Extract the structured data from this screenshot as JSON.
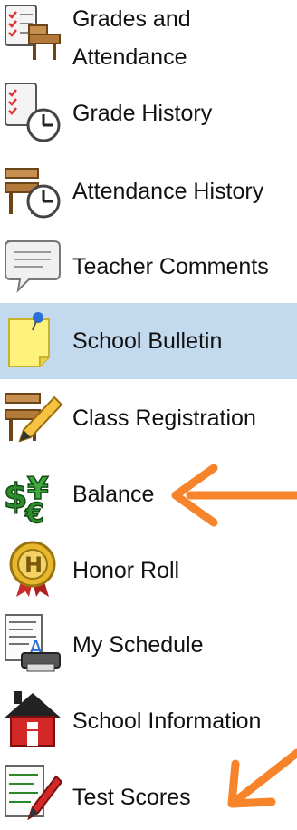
{
  "menu": {
    "items": [
      {
        "label": "Grades and\nAttendance",
        "icon": "grades-attendance-icon"
      },
      {
        "label": "Grade History",
        "icon": "grade-history-icon"
      },
      {
        "label": "Attendance History",
        "icon": "attendance-history-icon"
      },
      {
        "label": "Teacher Comments",
        "icon": "teacher-comments-icon"
      },
      {
        "label": "School Bulletin",
        "icon": "school-bulletin-icon",
        "selected": true
      },
      {
        "label": "Class Registration",
        "icon": "class-registration-icon"
      },
      {
        "label": "Balance",
        "icon": "balance-icon"
      },
      {
        "label": "Honor Roll",
        "icon": "honor-roll-icon"
      },
      {
        "label": "My Schedule",
        "icon": "my-schedule-icon"
      },
      {
        "label": "School Information",
        "icon": "school-information-icon"
      },
      {
        "label": "Test Scores",
        "icon": "test-scores-icon"
      }
    ]
  },
  "colors": {
    "selected_background": "#c3d9ee",
    "annotation_arrow": "#f7842a"
  }
}
